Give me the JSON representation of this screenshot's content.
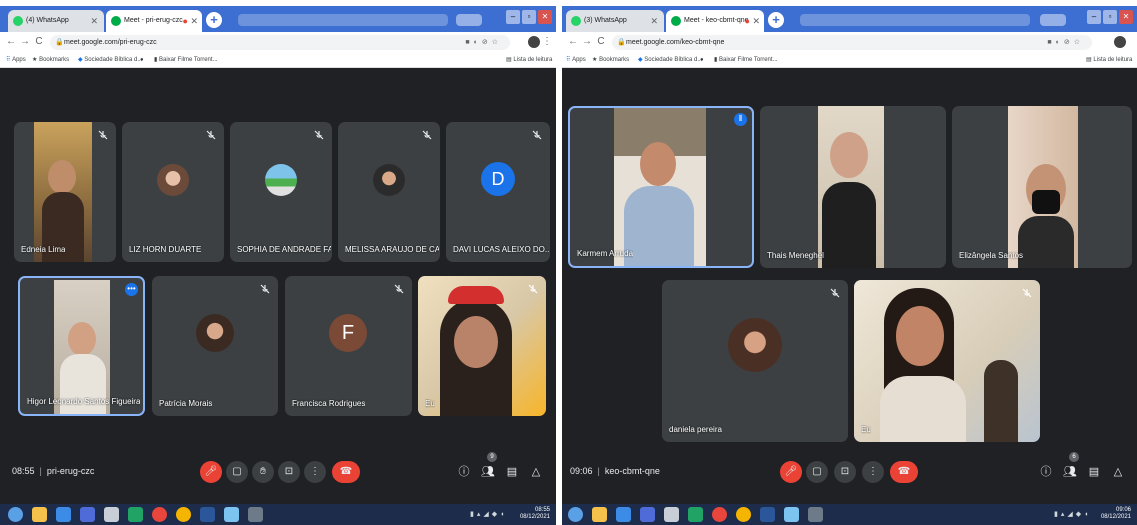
{
  "left": {
    "tabs": [
      {
        "title": "(4) WhatsApp"
      },
      {
        "title": "Meet - pri-erug-czc"
      }
    ],
    "url": "meet.google.com/pri-erug-czc",
    "bookmarks": {
      "apps": "Apps",
      "bookmarks": "Bookmarks",
      "sociedade": "Sociedade Bíblica d...",
      "baixar": "Baixar Filme Torrent...",
      "reading_list": "Lista de leitura"
    },
    "participants": [
      {
        "name": "Edneia Lima"
      },
      {
        "name": "LIZ HORN DUARTE"
      },
      {
        "name": "SOPHIA DE ANDRADE FA..."
      },
      {
        "name": "MELISSA ARAUJO DE CA..."
      },
      {
        "name": "DAVI LUCAS ALEIXO DO...",
        "initial": "D"
      },
      {
        "name": "Higor Leonardo Santos Figueira"
      },
      {
        "name": "Patrícia Morais"
      },
      {
        "name": "Francisca Rodrigues",
        "initial": "F"
      },
      {
        "name": "Eu"
      }
    ],
    "meeting": {
      "time": "08:55",
      "separator": "|",
      "code": "pri-erug-czc",
      "people_count": "9"
    },
    "clock": {
      "time": "08:55",
      "date": "08/12/2021"
    }
  },
  "right": {
    "tabs": [
      {
        "title": "(3) WhatsApp"
      },
      {
        "title": "Meet - keo-cbmt-qne"
      }
    ],
    "url": "meet.google.com/keo-cbmt-qne",
    "bookmarks": {
      "apps": "Apps",
      "bookmarks": "Bookmarks",
      "sociedade": "Sociedade Bíblica d...",
      "baixar": "Baixar Filme Torrent...",
      "reading_list": "Lista de leitura"
    },
    "participants": [
      {
        "name": "Karmem Arruda"
      },
      {
        "name": "Thais Meneghel"
      },
      {
        "name": "Elizângela Santos"
      },
      {
        "name": "daniela pereira"
      },
      {
        "name": "Eu"
      }
    ],
    "meeting": {
      "time": "09:06",
      "separator": "|",
      "code": "keo-cbmt-qne",
      "people_count": "6"
    },
    "clock": {
      "time": "09:06",
      "date": "08/12/2021"
    }
  },
  "colors": {
    "meet_bg": "#202124",
    "tile_bg": "#3c4043",
    "hangup": "#ea4335",
    "speaking": "#8ab4f8",
    "chrome_frame": "#3c6fd1",
    "taskbar": "#1d2c4a"
  }
}
